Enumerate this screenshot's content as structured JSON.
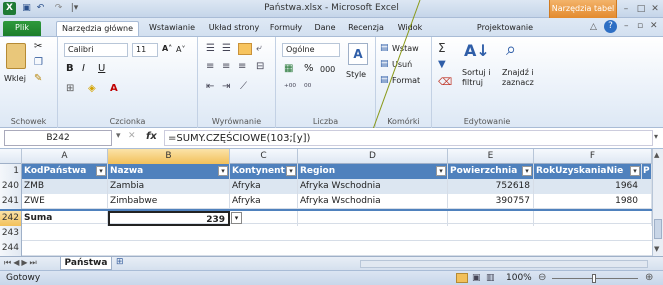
{
  "window": {
    "title": "Państwa.xlsx - Microsoft Excel",
    "context_tab": "Narzędzia tabel",
    "excel_icon_letter": "X"
  },
  "tabs": [
    "Plik",
    "Narzędzia główne",
    "Wstawianie",
    "Układ strony",
    "Formuły",
    "Dane",
    "Recenzja",
    "Widok",
    "Projektowanie"
  ],
  "ribbon": {
    "clipboard": {
      "label": "Schowek",
      "paste": "Wklej"
    },
    "font": {
      "label": "Czcionka",
      "name": "Calibri",
      "size": "11",
      "bold": "B",
      "italic": "I",
      "underline": "U",
      "grow": "A˄",
      "shrink": "A˅",
      "fontcolor": "A"
    },
    "alignment": {
      "label": "Wyrównanie"
    },
    "number": {
      "label": "Liczba",
      "format": "Ogólne",
      "percent": "%",
      "thousands": "000"
    },
    "styles": {
      "label": "Style"
    },
    "cells": {
      "label": "Komórki",
      "insert": "Wstaw",
      "delete": "Usuń",
      "format": "Format"
    },
    "editing": {
      "label": "Edytowanie",
      "sort": "Sortuj i\nfiltruj",
      "sort1": "Sortuj i",
      "sort2": "filtruj",
      "find1": "Znajdź i",
      "find2": "zaznacz"
    }
  },
  "formula_bar": {
    "name_box": "B242",
    "fx": "fx",
    "formula": "=SUMY.CZĘŚCIOWE(103;[y])"
  },
  "columns": [
    "A",
    "B",
    "C",
    "D",
    "E",
    "F"
  ],
  "header_row": {
    "num": "1",
    "cells": [
      "KodPaństwa",
      "Nazwa",
      "Kontynent",
      "Region",
      "Powierzchnia",
      "RokUzyskaniaNie",
      "P"
    ]
  },
  "rows": [
    {
      "num": "240",
      "cells": [
        "ZMB",
        "Zambia",
        "Afryka",
        "Afryka Wschodnia",
        "752618",
        "1964"
      ]
    },
    {
      "num": "241",
      "cells": [
        "ZWE",
        "Zimbabwe",
        "Afryka",
        "Afryka Wschodnia",
        "390757",
        "1980"
      ]
    },
    {
      "num": "242",
      "cells": [
        "Suma",
        "239",
        "",
        "",
        "",
        ""
      ]
    },
    {
      "num": "243",
      "cells": [
        "",
        "",
        "",
        "",
        "",
        ""
      ]
    },
    {
      "num": "244",
      "cells": [
        "",
        "",
        "",
        "",
        "",
        ""
      ]
    }
  ],
  "sheet_tab": "Państwa",
  "status": {
    "left": "Gotowy",
    "zoom": "100%"
  },
  "colors": {
    "accent": "#4f81bd",
    "file_tab": "#1c7d2b",
    "context": "#e38a2e"
  }
}
